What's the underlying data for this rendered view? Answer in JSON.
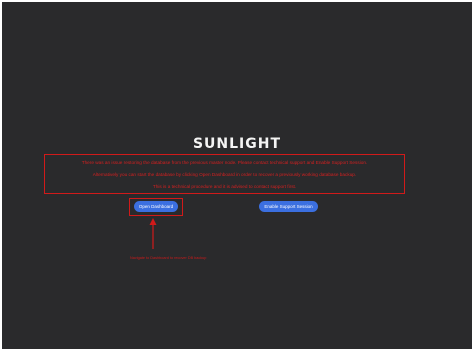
{
  "logo": {
    "text": "SUNLIGHT"
  },
  "message": {
    "line1": "There was an issue restoring the database from the previous master node. Please contact technical support and Enable Support Session.",
    "line2": "Alternatively you can start the database by clicking Open Dashboard in order to recover a previously working database backup.",
    "line3": "This is a technical procedure and it is advised to contact support first."
  },
  "buttons": {
    "open_dashboard": "Open Dashboard",
    "enable_support": "Enable Support Session"
  },
  "annotation": {
    "text": "Navigate to Dashboard to recover DB backup"
  },
  "colors": {
    "background": "#2a2a2c",
    "highlight": "#d11a1a",
    "button": "#3b6fe0"
  }
}
